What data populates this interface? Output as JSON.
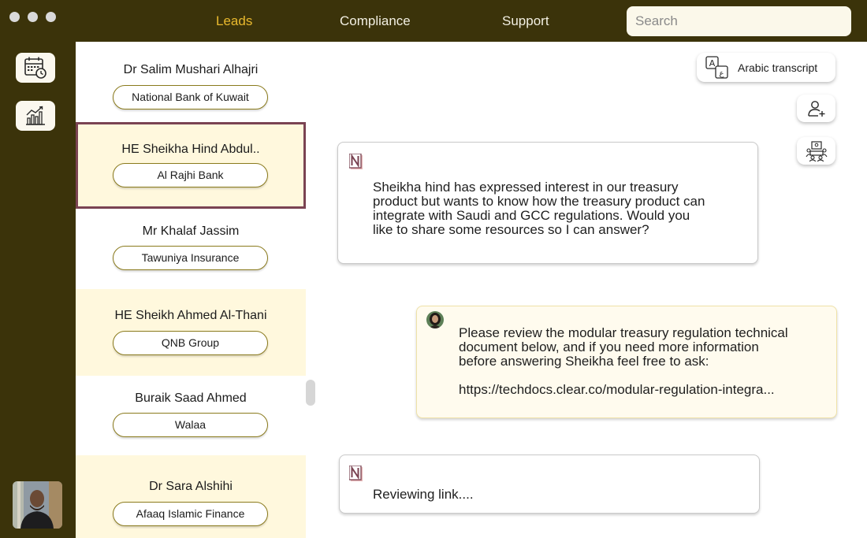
{
  "window": {
    "controls": [
      "close",
      "minimize",
      "maximize"
    ]
  },
  "nav": {
    "items": [
      {
        "label": "Leads",
        "active": true
      },
      {
        "label": "Compliance",
        "active": false
      },
      {
        "label": "Support",
        "active": false
      }
    ],
    "search_placeholder": "Search"
  },
  "sidebar": {
    "buttons": [
      {
        "icon": "calendar-clock-icon"
      },
      {
        "icon": "bar-chart-icon"
      }
    ],
    "profile_avatar": "user-avatar"
  },
  "leads": [
    {
      "name": "Dr Salim Mushari Alhajri",
      "company": "National Bank of Kuwait",
      "state": "plain"
    },
    {
      "name": "HE Sheikha Hind Abdul..",
      "company": "Al Rajhi Bank",
      "state": "selected"
    },
    {
      "name": "Mr Khalaf Jassim",
      "company": "Tawuniya Insurance",
      "state": "plain"
    },
    {
      "name": "HE Sheikh Ahmed Al-Thani",
      "company": "QNB Group",
      "state": "cream"
    },
    {
      "name": "Buraik Saad Ahmed",
      "company": "Walaa",
      "state": "plain"
    },
    {
      "name": "Dr Sara Alshihi",
      "company": "Afaaq Islamic Finance",
      "state": "cream"
    }
  ],
  "actions": {
    "transcript_label": "Arabic transcript",
    "transcript_icon": "translate-icon",
    "add_contact_icon": "add-user-icon",
    "meeting_icon": "meeting-icon"
  },
  "messages": [
    {
      "sender": "assistant",
      "icon": "n-logo-icon",
      "lines": [
        "Sheikha hind has expressed interest in our treasury",
        "product but wants to know how the treasury product can",
        "integrate with Saudi and GCC regulations. Would you",
        "like to share some resources so I can answer?"
      ]
    },
    {
      "sender": "user",
      "icon": "user-avatar",
      "lines": [
        "Please review the modular treasury regulation technical",
        "document below, and if you need more information",
        "before answering Sheikha feel free to ask:"
      ],
      "link": "https://techdocs.clear.co/modular-regulation-integra..."
    },
    {
      "sender": "assistant",
      "icon": "n-logo-icon",
      "lines": [
        "Reviewing link...."
      ]
    }
  ],
  "colors": {
    "chrome": "#3b330a",
    "accent": "#e9b92e",
    "selected_border": "#7a4352",
    "cream": "#fff8dd"
  }
}
